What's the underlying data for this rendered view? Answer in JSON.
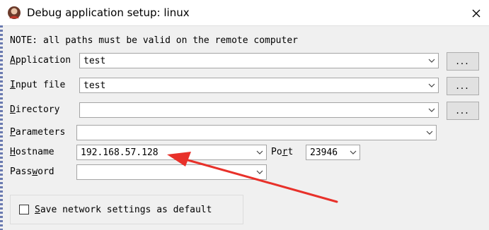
{
  "window": {
    "title": "Debug application setup: linux"
  },
  "note": "NOTE: all paths must be valid on the remote computer",
  "fields": {
    "application": {
      "mnemonic": "A",
      "rest": "pplication",
      "value": "test"
    },
    "input_file": {
      "mnemonic": "I",
      "rest": "nput file",
      "value": "test"
    },
    "directory": {
      "mnemonic": "D",
      "rest": "irectory",
      "value": ""
    },
    "parameters": {
      "mnemonic": "P",
      "rest": "arameters",
      "value": ""
    },
    "hostname": {
      "mnemonic": "H",
      "rest": "ostname",
      "value": "192.168.57.128"
    },
    "port": {
      "pre": "Po",
      "mnemonic": "r",
      "rest": "t",
      "value": "23946"
    },
    "password": {
      "pre": "Pass",
      "mnemonic": "w",
      "rest": "ord",
      "value": ""
    }
  },
  "browse_label": "...",
  "save_default": {
    "mnemonic": "S",
    "rest": "ave network settings as default",
    "checked": false
  },
  "annotation": {
    "color": "#e8312a"
  }
}
